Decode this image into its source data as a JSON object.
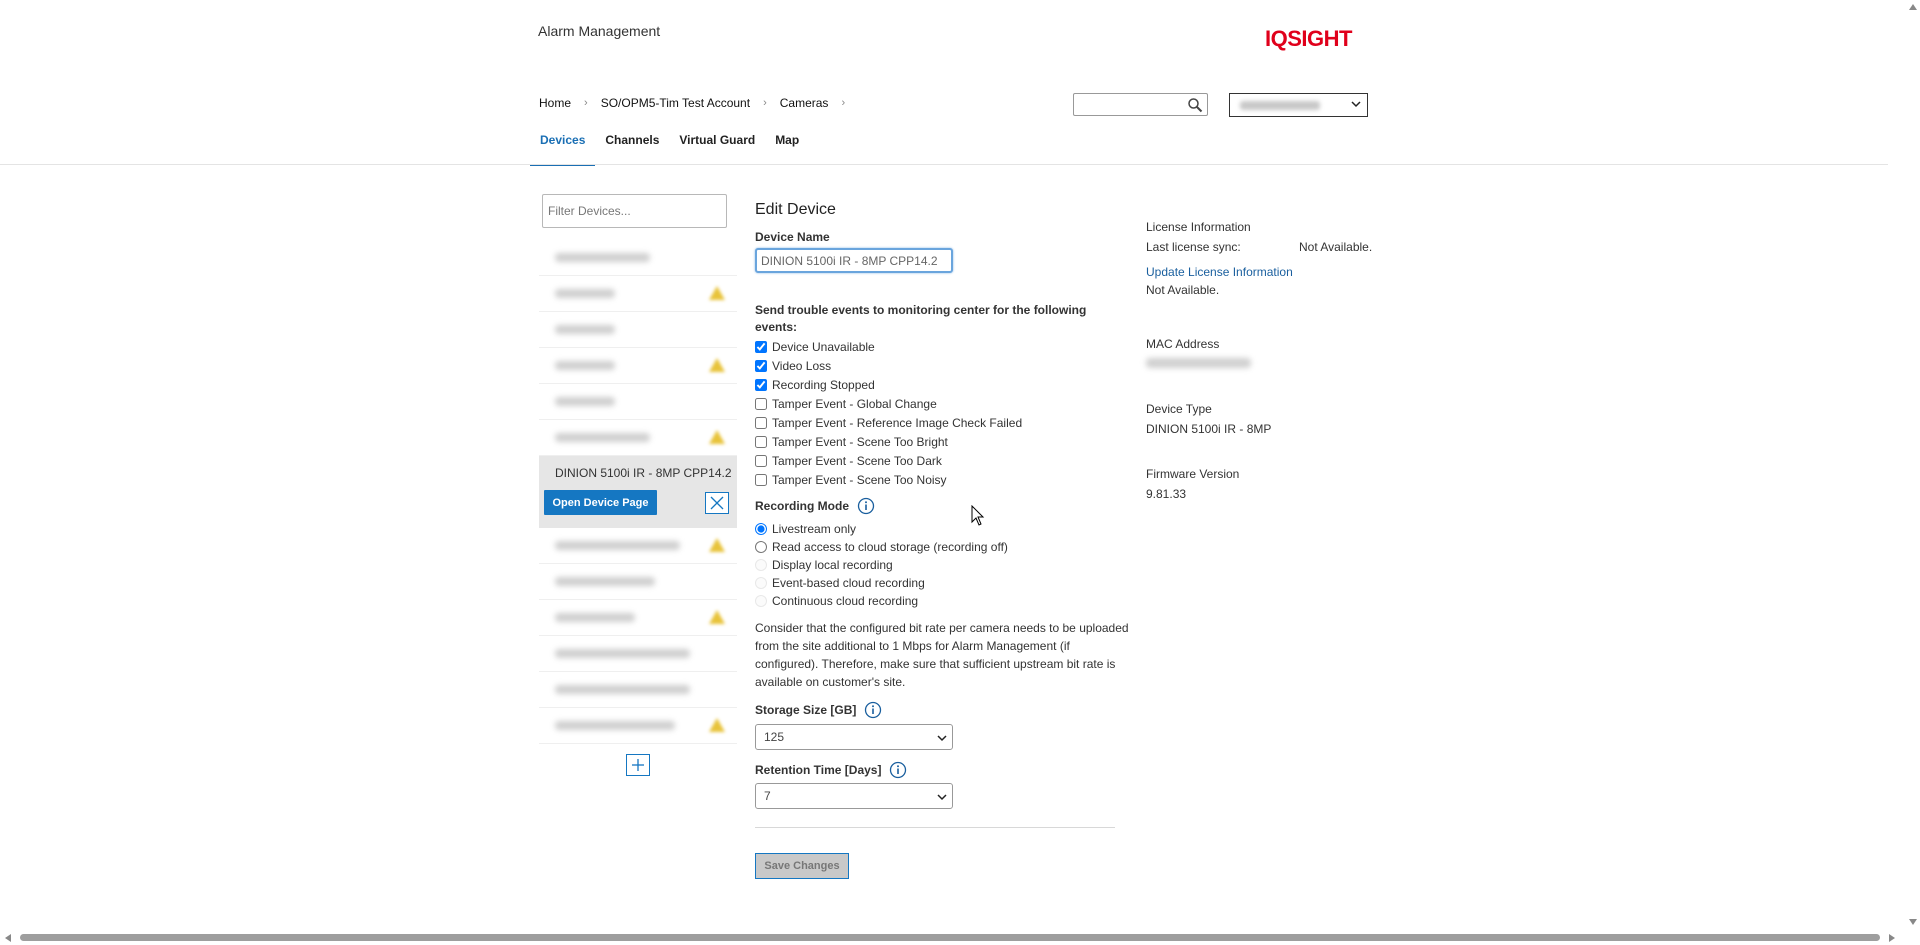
{
  "app": {
    "title": "Alarm Management",
    "logo": "IQSIGHT",
    "logo_color": "#e0001b"
  },
  "breadcrumb": {
    "items": [
      "Home",
      "SO/OPM5-Tim Test Account",
      "Cameras"
    ]
  },
  "search": {
    "placeholder": "",
    "icon": "search-icon"
  },
  "account_select": {
    "value": ""
  },
  "tabs": [
    {
      "label": "Devices",
      "active": true
    },
    {
      "label": "Channels",
      "active": false
    },
    {
      "label": "Virtual Guard",
      "active": false
    },
    {
      "label": "Map",
      "active": false
    }
  ],
  "sidebar": {
    "filter_placeholder": "Filter Devices...",
    "selected_device": {
      "name": "DINION 5100i IR - 8MP CPP14.2",
      "open_label": "Open Device Page"
    }
  },
  "form": {
    "heading": "Edit Device",
    "device_name_label": "Device Name",
    "device_name_value": "DINION 5100i IR - 8MP CPP14.2",
    "events_heading": "Send trouble events to monitoring center for the following events:",
    "events": [
      {
        "label": "Device Unavailable",
        "checked": true
      },
      {
        "label": "Video Loss",
        "checked": true
      },
      {
        "label": "Recording Stopped",
        "checked": true
      },
      {
        "label": "Tamper Event - Global Change",
        "checked": false
      },
      {
        "label": "Tamper Event - Reference Image Check Failed",
        "checked": false
      },
      {
        "label": "Tamper Event - Scene Too Bright",
        "checked": false
      },
      {
        "label": "Tamper Event - Scene Too Dark",
        "checked": false
      },
      {
        "label": "Tamper Event - Scene Too Noisy",
        "checked": false
      }
    ],
    "recording_mode_label": "Recording Mode",
    "recording_modes": [
      {
        "label": "Livestream only",
        "selected": true,
        "enabled": true
      },
      {
        "label": "Read access to cloud storage (recording off)",
        "selected": false,
        "enabled": true
      },
      {
        "label": "Display local recording",
        "selected": false,
        "enabled": false
      },
      {
        "label": "Event-based cloud recording",
        "selected": false,
        "enabled": false
      },
      {
        "label": "Continuous cloud recording",
        "selected": false,
        "enabled": false
      }
    ],
    "note": "Consider that the configured bit rate per camera needs to be uploaded from the site additional to 1 Mbps for Alarm Management (if configured). Therefore, make sure that sufficient upstream bit rate is available on customer's site.",
    "storage_label": "Storage Size [GB]",
    "storage_value": "125",
    "retention_label": "Retention Time [Days]",
    "retention_value": "7",
    "save_label": "Save Changes"
  },
  "info": {
    "license_title": "License Information",
    "last_sync_label": "Last license sync:",
    "last_sync_value": "Not Available.",
    "update_link": "Update License Information",
    "license_status": "Not Available.",
    "mac_title": "MAC Address",
    "device_type_title": "Device Type",
    "device_type_value": "DINION 5100i IR - 8MP",
    "firmware_title": "Firmware Version",
    "firmware_value": "9.81.33"
  },
  "colors": {
    "accent": "#1577c2",
    "link": "#1a5f9e",
    "tab_active": "#1a6fb4"
  }
}
